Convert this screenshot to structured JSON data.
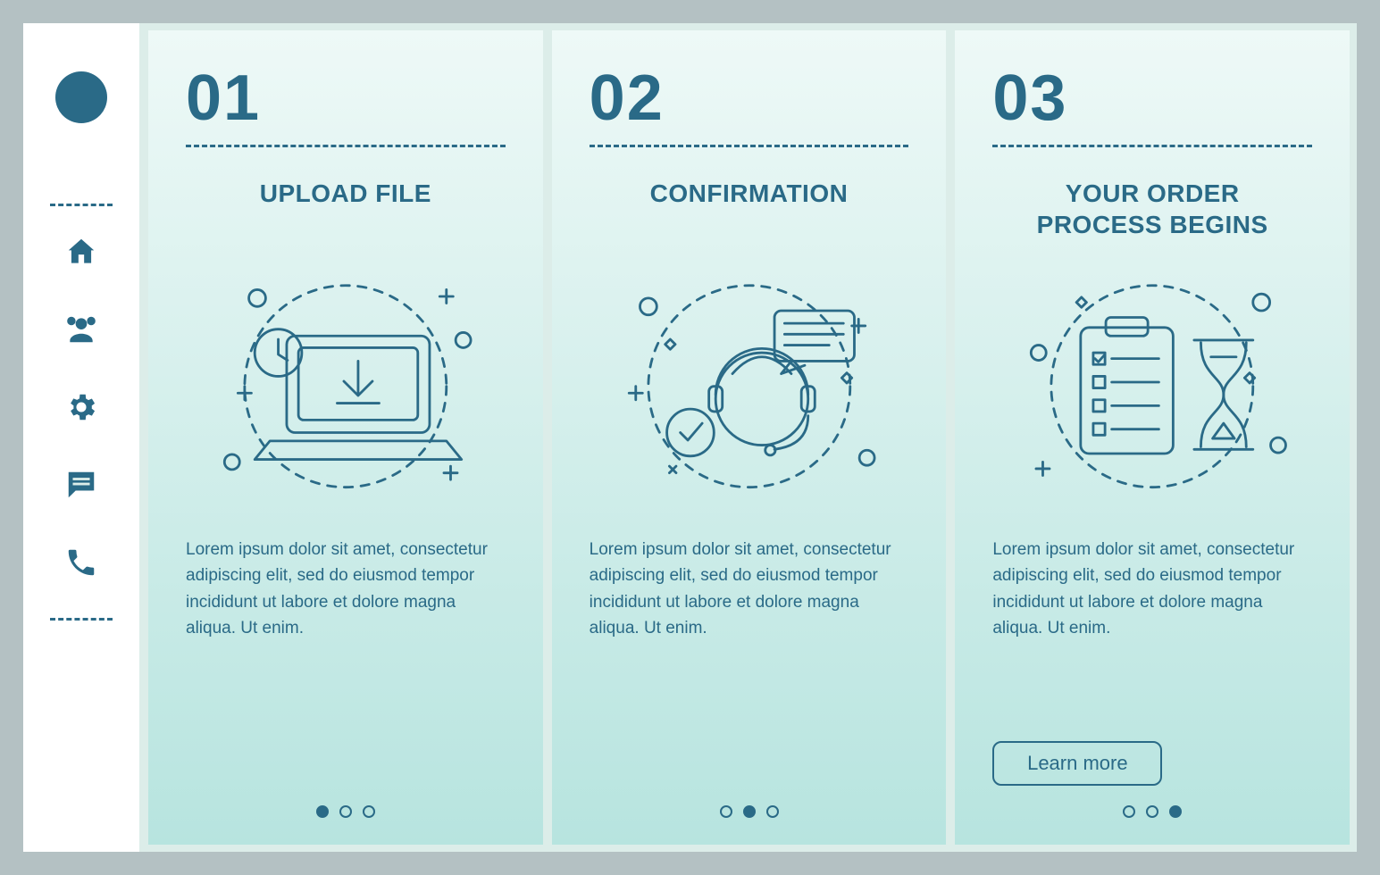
{
  "colors": {
    "primary": "#2a6a87",
    "card_bg_top": "#eef9f7",
    "card_bg_bottom": "#b7e4df"
  },
  "sidebar": {
    "icons": [
      "home-icon",
      "users-icon",
      "gear-icon",
      "chat-icon",
      "phone-icon"
    ]
  },
  "cards": [
    {
      "number": "01",
      "title": "UPLOAD FILE",
      "body": "Lorem ipsum dolor sit amet, consectetur adipiscing elit, sed do eiusmod tempor incididunt ut labore et dolore magna aliqua. Ut enim.",
      "active_dot": 0
    },
    {
      "number": "02",
      "title": "CONFIRMATION",
      "body": "Lorem ipsum dolor sit amet, consectetur adipiscing elit, sed do eiusmod tempor incididunt ut labore et dolore magna aliqua. Ut enim.",
      "active_dot": 1
    },
    {
      "number": "03",
      "title": "YOUR ORDER\nPROCESS BEGINS",
      "body": "Lorem ipsum dolor sit amet, consectetur adipiscing elit, sed do eiusmod tempor incididunt ut labore et dolore magna aliqua. Ut enim.",
      "active_dot": 2,
      "cta": "Learn more"
    }
  ]
}
